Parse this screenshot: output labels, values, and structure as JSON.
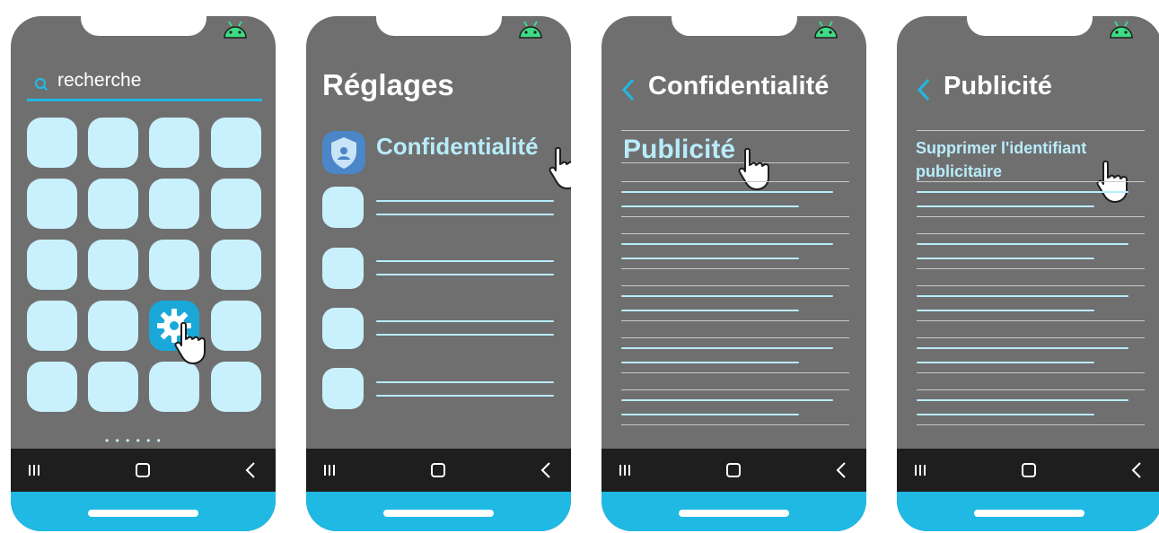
{
  "colors": {
    "screen_bg": "#6f6f6f",
    "accent": "#1fb9e4",
    "tile": "#c9f1fd",
    "navbar": "#1e1e1e",
    "android_green": "#3ddc84"
  },
  "screen1": {
    "search": {
      "icon": "search-icon",
      "value": "recherche"
    },
    "page_dots": "• • • • • •",
    "highlighted_app_icon": "gear-icon"
  },
  "screen2": {
    "title": "Réglages",
    "first_item": {
      "icon": "shield-icon",
      "label": "Confidentialité"
    }
  },
  "screen3": {
    "title": "Confidentialité",
    "first_item": "Publicité"
  },
  "screen4": {
    "title": "Publicité",
    "first_item": "Supprimer l'identifiant publicitaire"
  },
  "navbar_icons": [
    "recents-icon",
    "home-icon",
    "back-icon"
  ]
}
